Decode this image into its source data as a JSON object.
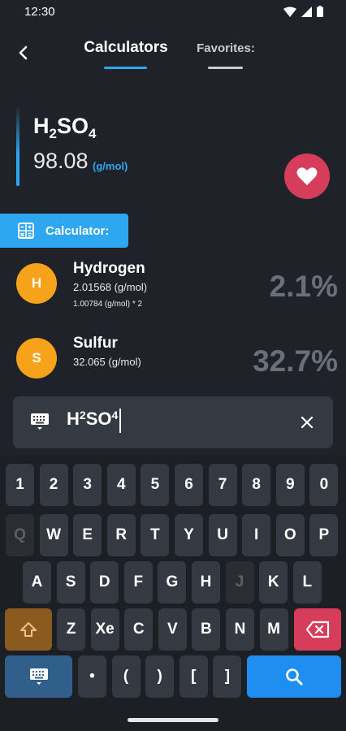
{
  "status": {
    "time": "12:30"
  },
  "header": {
    "tabs": [
      {
        "label": "Calculators",
        "active": true
      },
      {
        "label": "Favorites:",
        "active": false
      }
    ]
  },
  "formula": {
    "parts": [
      "H",
      "2",
      "SO",
      "4"
    ],
    "molar_mass": "98.08",
    "unit": "(g/mol)"
  },
  "calculator_tab": {
    "label": "Calculator:"
  },
  "elements": [
    {
      "symbol": "H",
      "name": "Hydrogen",
      "mass": "2.01568 (g/mol)",
      "calc": "1.00784 (g/mol) * 2",
      "percent": "2.1%"
    },
    {
      "symbol": "S",
      "name": "Sulfur",
      "mass": "32.065 (g/mol)",
      "calc": "",
      "percent": "32.7%"
    }
  ],
  "input": {
    "parts": [
      "H",
      "2",
      "SO",
      "4"
    ]
  },
  "keyboard": {
    "row1": [
      "1",
      "2",
      "3",
      "4",
      "5",
      "6",
      "7",
      "8",
      "9",
      "0"
    ],
    "row2": [
      "Q",
      "W",
      "E",
      "R",
      "T",
      "Y",
      "U",
      "I",
      "O",
      "P"
    ],
    "row3": [
      "A",
      "S",
      "D",
      "F",
      "G",
      "H",
      "J",
      "K",
      "L"
    ],
    "row4": [
      "Z",
      "Xe",
      "C",
      "V",
      "B",
      "N",
      "M"
    ],
    "row5": [
      "•",
      "(",
      ")",
      "[",
      "]"
    ],
    "disabled": [
      "Q",
      "J"
    ]
  },
  "colors": {
    "accent": "#2ea6f0",
    "favorite": "#d63d5b",
    "element_badge": "#f6a21a",
    "shift": "#8a5a1e",
    "search_key": "#1e8ef0"
  },
  "icons": [
    "back-arrow-icon",
    "heart-icon",
    "calculator-icon",
    "keyboard-icon",
    "close-icon",
    "shift-icon",
    "backspace-icon",
    "search-icon"
  ]
}
